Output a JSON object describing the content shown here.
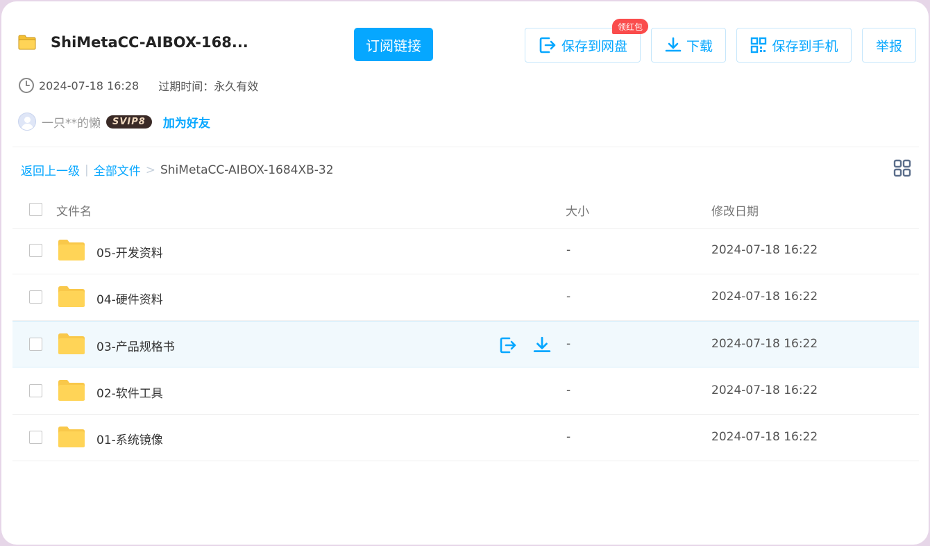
{
  "share": {
    "title": "ShiMetaCC-AIBOX-168...",
    "subscribe_label": "订阅链接",
    "buttons": {
      "save_to_disk": "保存到网盘",
      "red_packet_badge": "领红包",
      "download": "下载",
      "save_to_phone": "保存到手机",
      "report": "举报"
    },
    "created_time": "2024-07-18 16:28",
    "expire_text": "过期时间：永久有效",
    "user": {
      "name": "一只**的懒",
      "vip_badge": "SVIP8",
      "add_friend": "加为好友"
    }
  },
  "breadcrumb": {
    "back": "返回上一级",
    "sep": "|",
    "all_files": "全部文件",
    "arrow": ">",
    "current": "ShiMetaCC-AIBOX-1684XB-32"
  },
  "table": {
    "headers": {
      "name": "文件名",
      "size": "大小",
      "date": "修改日期"
    },
    "rows": [
      {
        "name": "05-开发资料",
        "size": "-",
        "date": "2024-07-18 16:22"
      },
      {
        "name": "04-硬件资料",
        "size": "-",
        "date": "2024-07-18 16:22"
      },
      {
        "name": "03-产品规格书",
        "size": "-",
        "date": "2024-07-18 16:22"
      },
      {
        "name": "02-软件工具",
        "size": "-",
        "date": "2024-07-18 16:22"
      },
      {
        "name": "01-系统镜像",
        "size": "-",
        "date": "2024-07-18 16:22"
      }
    ]
  },
  "colors": {
    "accent": "#06a7ff",
    "folder": "#ffd457",
    "badge": "#fa4c4c",
    "hover_row": "#f1f9fd"
  },
  "icons": [
    "folder-icon",
    "clock-icon",
    "save-to-disk-icon",
    "download-icon",
    "qr-phone-icon",
    "grid-view-icon",
    "avatar"
  ]
}
